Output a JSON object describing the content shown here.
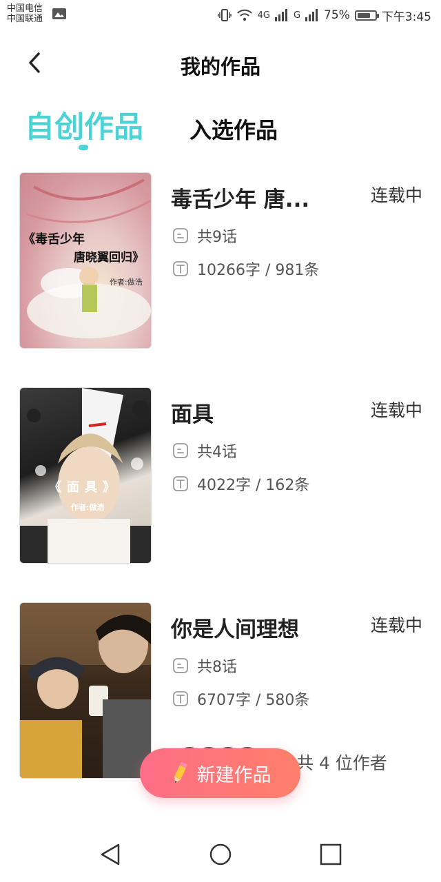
{
  "status_bar": {
    "carrier_1": "中国电信",
    "carrier_2": "中国联通",
    "net_4g": "4G",
    "net_g": "G",
    "battery": "75%",
    "battery_level": 0.75,
    "time": "下午3:45"
  },
  "header": {
    "title": "我的作品"
  },
  "tabs": [
    {
      "label": "自创作品",
      "active": true
    },
    {
      "label": "入选作品",
      "active": false
    }
  ],
  "works": [
    {
      "name": "毒舌少年 唐...",
      "status": "连载中",
      "episodes": "共9话",
      "stats": "10266字 / 981条",
      "cover_text_1": "《毒舌少年",
      "cover_text_2": "唐晓翼回归》",
      "cover_author": "作者:做浩"
    },
    {
      "name": "面具",
      "status": "连载中",
      "episodes": "共4话",
      "stats": "4022字 / 162条",
      "cover_text_1": "《面具》",
      "cover_author": "作者:做浩"
    },
    {
      "name": "你是人间理想",
      "status": "连载中",
      "episodes": "共8话",
      "stats": "6707字 / 580条",
      "authors_count": "共 4 位作者"
    }
  ],
  "new_button": {
    "label": "新建作品"
  },
  "colors": {
    "accent": "#4fd2d6",
    "button": "#ff7a7a"
  }
}
